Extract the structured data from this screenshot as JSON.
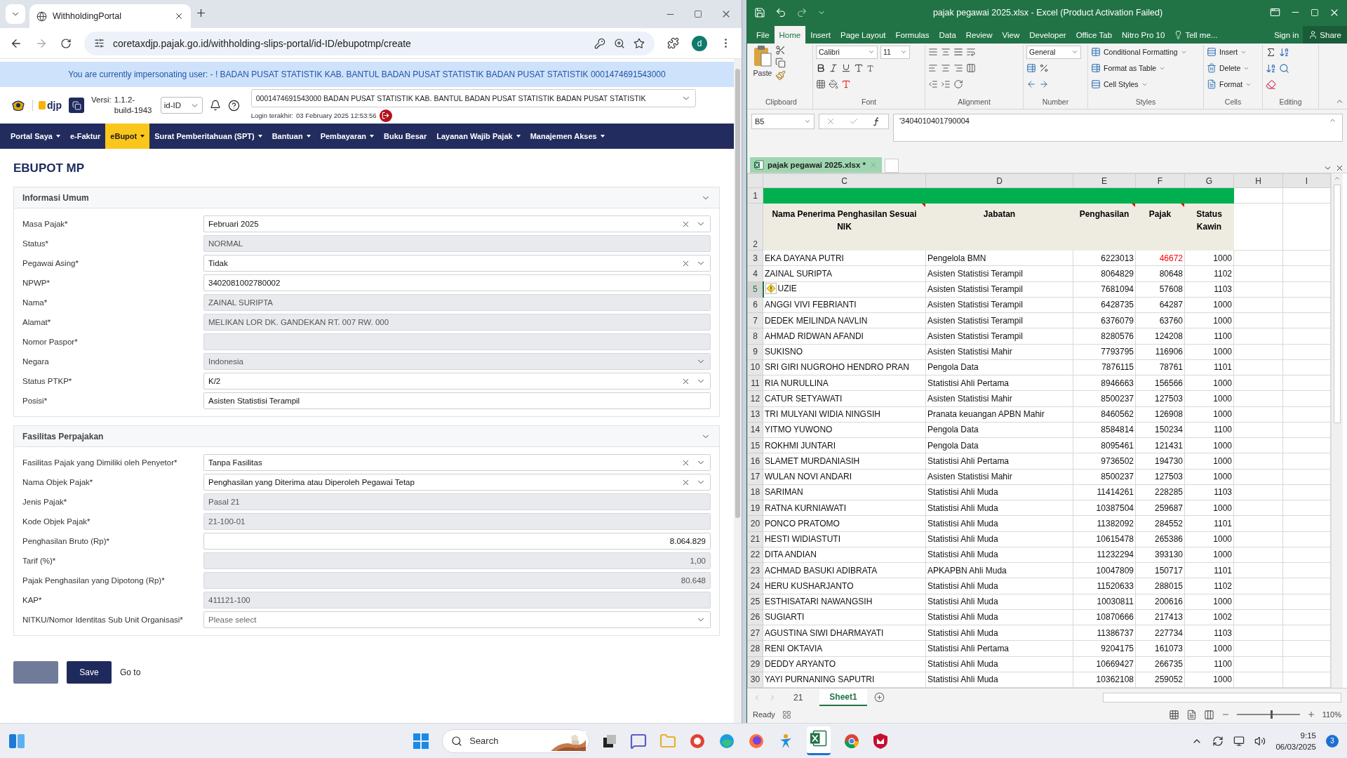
{
  "browser": {
    "tab_title": "WithholdingPortal",
    "url": "coretaxdjp.pajak.go.id/withholding-slips-portal/id-ID/ebupotmp/create",
    "profile_initial": "d"
  },
  "portal": {
    "banner": "You are currently impersonating user: - ! BADAN PUSAT STATISTIK KAB. BANTUL BADAN PUSAT STATISTIK BADAN PUSAT STATISTIK 0001474691543000",
    "logo_text": "djp",
    "version_label": "Versi:",
    "version": "1.1.2-build-1943",
    "language": "id-ID",
    "company": "0001474691543000 BADAN PUSAT STATISTIK KAB. BANTUL BADAN PUSAT STATISTIK BADAN PUSAT STATISTIK",
    "login_label": "Login terakhir:",
    "login_time": "03 February 2025 12:53:56",
    "nav": [
      {
        "label": "Portal Saya",
        "dropdown": true,
        "selected": false
      },
      {
        "label": "e-Faktur",
        "dropdown": false,
        "selected": false
      },
      {
        "label": "eBupot",
        "dropdown": true,
        "selected": true
      },
      {
        "label": "Surat Pemberitahuan (SPT)",
        "dropdown": true,
        "selected": false
      },
      {
        "label": "Bantuan",
        "dropdown": true,
        "selected": false
      },
      {
        "label": "Pembayaran",
        "dropdown": true,
        "selected": false
      },
      {
        "label": "Buku Besar",
        "dropdown": false,
        "selected": false
      },
      {
        "label": "Layanan Wajib Pajak",
        "dropdown": true,
        "selected": false
      },
      {
        "label": "Manajemen Akses",
        "dropdown": true,
        "selected": false
      }
    ],
    "title": "EBUPOT MP",
    "sections": [
      {
        "title": "Informasi Umum",
        "expanded": true,
        "fields": [
          {
            "label": "Masa Pajak*",
            "kind": "select",
            "disabled": false,
            "clearable": true,
            "value": "Februari 2025"
          },
          {
            "label": "Status*",
            "kind": "text",
            "disabled": true,
            "value": "NORMAL"
          },
          {
            "label": "Pegawai Asing*",
            "kind": "select",
            "disabled": false,
            "clearable": true,
            "value": "Tidak"
          },
          {
            "label": "NPWP*",
            "kind": "text",
            "disabled": false,
            "value": "3402081002780002"
          },
          {
            "label": "Nama*",
            "kind": "text",
            "disabled": true,
            "value": "ZAINAL SURIPTA"
          },
          {
            "label": "Alamat*",
            "kind": "text",
            "disabled": true,
            "value": "MELIKAN LOR DK. GANDEKAN RT. 007 RW. 000"
          },
          {
            "label": "Nomor Paspor*",
            "kind": "text",
            "disabled": true
          },
          {
            "label": "Negara",
            "kind": "select",
            "disabled": true,
            "clearable": false,
            "value": "Indonesia"
          },
          {
            "label": "Status PTKP*",
            "kind": "select",
            "disabled": false,
            "clearable": true,
            "value": "K/2"
          },
          {
            "label": "Posisi*",
            "kind": "text",
            "disabled": false,
            "value": "Asisten Statistisi Terampil"
          }
        ]
      },
      {
        "title": "Fasilitas Perpajakan",
        "expanded": true,
        "fields": [
          {
            "label": "Fasilitas Pajak yang Dimiliki oleh Penyetor*",
            "kind": "select",
            "disabled": false,
            "clearable": true,
            "value": "Tanpa Fasilitas"
          },
          {
            "label": "Nama Objek Pajak*",
            "kind": "select",
            "disabled": false,
            "clearable": true,
            "value": "Penghasilan yang Diterima atau Diperoleh Pegawai Tetap"
          },
          {
            "label": "Jenis Pajak*",
            "kind": "text",
            "disabled": true,
            "value": "Pasal 21"
          },
          {
            "label": "Kode Objek Pajak*",
            "kind": "text",
            "disabled": true,
            "value": "21-100-01"
          },
          {
            "label": "Penghasilan Bruto (Rp)*",
            "kind": "number",
            "disabled": false,
            "value": "8.064.829"
          },
          {
            "label": "Tarif (%)*",
            "kind": "number",
            "disabled": true,
            "value": "1,00"
          },
          {
            "label": "Pajak Penghasilan yang Dipotong (Rp)*",
            "kind": "number",
            "disabled": true,
            "value": "80.648"
          },
          {
            "label": "KAP*",
            "kind": "text",
            "disabled": true,
            "value": "411121-100"
          },
          {
            "label": "NITKU/Nomor Identitas Sub Unit Organisasi*",
            "kind": "select",
            "disabled": false,
            "clearable": false,
            "placeholder": "Please select"
          }
        ]
      }
    ],
    "buttons": [
      {
        "kind": "secondary"
      },
      {
        "kind": "primary",
        "label": "Save"
      },
      {
        "kind": "link",
        "label": "Go to"
      }
    ]
  },
  "excel": {
    "title": "pajak pegawai 2025.xlsx - Excel (Product Activation Failed)",
    "tabs": [
      {
        "label": "File",
        "selected": false
      },
      {
        "label": "Home",
        "selected": true
      },
      {
        "label": "Insert",
        "selected": false
      },
      {
        "label": "Page Layout",
        "selected": false
      },
      {
        "label": "Formulas",
        "selected": false
      },
      {
        "label": "Data",
        "selected": false
      },
      {
        "label": "Review",
        "selected": false
      },
      {
        "label": "View",
        "selected": false
      },
      {
        "label": "Developer",
        "selected": false
      },
      {
        "label": "Office Tab",
        "selected": false
      },
      {
        "label": "Nitro Pro 10",
        "selected": false
      }
    ],
    "tell_me": "Tell me...",
    "sign_in": "Sign in",
    "share": "Share",
    "ribbon": {
      "clipboard": "Clipboard",
      "paste": "Paste",
      "font_group": "Font",
      "font": "Calibri",
      "size": "11",
      "alignment": "Alignment",
      "number_group": "Number",
      "number_format": "General",
      "styles_group": "Styles",
      "styles": [
        "Conditional Formatting",
        "Format as Table",
        "Cell Styles"
      ],
      "cells_group": "Cells",
      "cells": [
        "Insert",
        "Delete",
        "Format"
      ],
      "editing": "Editing"
    },
    "name_box": "B5",
    "formula": "'3404010401790004",
    "workbook_tab": "pajak pegawai 2025.xlsx *",
    "columns": [
      "C",
      "D",
      "E",
      "F",
      "G",
      "H",
      "I"
    ],
    "header_rows": [
      "1",
      "2"
    ],
    "headers": [
      {
        "text": "Nama Penerima Penghasilan Sesuai NIK",
        "comment": true
      },
      {
        "text": "Jabatan",
        "comment": false
      },
      {
        "text": "Penghasilan",
        "comment": true
      },
      {
        "text": "Pajak",
        "comment": true
      },
      {
        "text": "Status Kawin",
        "comment": false
      }
    ],
    "rows": [
      {
        "row": "3",
        "name": "EKA DAYANA PUTRI",
        "jabatan": "Pengelola BMN",
        "penghasilan": "6223013",
        "pajak": "46672",
        "status": "1000",
        "pajak_red": true,
        "selected": false,
        "warning": false
      },
      {
        "row": "4",
        "name": "ZAINAL SURIPTA",
        "jabatan": "Asisten Statistisi Terampil",
        "penghasilan": "8064829",
        "pajak": "80648",
        "status": "1102",
        "pajak_red": false,
        "selected": false,
        "warning": false
      },
      {
        "row": "5",
        "name": "UZIE",
        "jabatan": "Asisten Statistisi Terampil",
        "penghasilan": "7681094",
        "pajak": "57608",
        "status": "1103",
        "pajak_red": false,
        "selected": true,
        "warning": true
      },
      {
        "row": "6",
        "name": "ANGGI VIVI FEBRIANTI",
        "jabatan": "Asisten Statistisi Terampil",
        "penghasilan": "6428735",
        "pajak": "64287",
        "status": "1000",
        "pajak_red": false,
        "selected": false,
        "warning": false
      },
      {
        "row": "7",
        "name": "DEDEK MEILINDA NAVLIN",
        "jabatan": "Asisten Statistisi Terampil",
        "penghasilan": "6376079",
        "pajak": "63760",
        "status": "1000",
        "pajak_red": false,
        "selected": false,
        "warning": false
      },
      {
        "row": "8",
        "name": "AHMAD RIDWAN AFANDI",
        "jabatan": "Asisten Statistisi Terampil",
        "penghasilan": "8280576",
        "pajak": "124208",
        "status": "1100",
        "pajak_red": false,
        "selected": false,
        "warning": false
      },
      {
        "row": "9",
        "name": "SUKISNO",
        "jabatan": "Asisten Statistisi Mahir",
        "penghasilan": "7793795",
        "pajak": "116906",
        "status": "1000",
        "pajak_red": false,
        "selected": false,
        "warning": false
      },
      {
        "row": "10",
        "name": "SRI GIRI NUGROHO HENDRO PRAN",
        "jabatan": "Pengola Data",
        "penghasilan": "7876115",
        "pajak": "78761",
        "status": "1101",
        "pajak_red": false,
        "selected": false,
        "warning": false
      },
      {
        "row": "11",
        "name": "RIA NURULLINA",
        "jabatan": "Statistisi Ahli Pertama",
        "penghasilan": "8946663",
        "pajak": "156566",
        "status": "1000",
        "pajak_red": false,
        "selected": false,
        "warning": false
      },
      {
        "row": "12",
        "name": "CATUR SETYAWATI",
        "jabatan": "Asisten Statistisi Mahir",
        "penghasilan": "8500237",
        "pajak": "127503",
        "status": "1000",
        "pajak_red": false,
        "selected": false,
        "warning": false
      },
      {
        "row": "13",
        "name": "TRI MULYANI WIDIA NINGSIH",
        "jabatan": "Pranata keuangan APBN Mahir",
        "penghasilan": "8460562",
        "pajak": "126908",
        "status": "1000",
        "pajak_red": false,
        "selected": false,
        "warning": false
      },
      {
        "row": "14",
        "name": "YITMO YUWONO",
        "jabatan": "Pengola Data",
        "penghasilan": "8584814",
        "pajak": "150234",
        "status": "1100",
        "pajak_red": false,
        "selected": false,
        "warning": false
      },
      {
        "row": "15",
        "name": "ROKHMI JUNTARI",
        "jabatan": "Pengola Data",
        "penghasilan": "8095461",
        "pajak": "121431",
        "status": "1000",
        "pajak_red": false,
        "selected": false,
        "warning": false
      },
      {
        "row": "16",
        "name": "SLAMET MURDANIASIH",
        "jabatan": "Statistisi Ahli Pertama",
        "penghasilan": "9736502",
        "pajak": "194730",
        "status": "1000",
        "pajak_red": false,
        "selected": false,
        "warning": false
      },
      {
        "row": "17",
        "name": "WULAN NOVI ANDARI",
        "jabatan": "Asisten Statistisi Mahir",
        "penghasilan": "8500237",
        "pajak": "127503",
        "status": "1000",
        "pajak_red": false,
        "selected": false,
        "warning": false
      },
      {
        "row": "18",
        "name": "SARIMAN",
        "jabatan": "Statistisi Ahli Muda",
        "penghasilan": "11414261",
        "pajak": "228285",
        "status": "1103",
        "pajak_red": false,
        "selected": false,
        "warning": false
      },
      {
        "row": "19",
        "name": "RATNA KURNIAWATI",
        "jabatan": "Statistisi Ahli Muda",
        "penghasilan": "10387504",
        "pajak": "259687",
        "status": "1000",
        "pajak_red": false,
        "selected": false,
        "warning": false
      },
      {
        "row": "20",
        "name": "PONCO PRATOMO",
        "jabatan": "Statistisi Ahli Muda",
        "penghasilan": "11382092",
        "pajak": "284552",
        "status": "1101",
        "pajak_red": false,
        "selected": false,
        "warning": false
      },
      {
        "row": "21",
        "name": "HESTI WIDIASTUTI",
        "jabatan": "Statistisi Ahli Muda",
        "penghasilan": "10615478",
        "pajak": "265386",
        "status": "1000",
        "pajak_red": false,
        "selected": false,
        "warning": false
      },
      {
        "row": "22",
        "name": "DITA ANDIAN",
        "jabatan": "Statistisi Ahli Muda",
        "penghasilan": "11232294",
        "pajak": "393130",
        "status": "1000",
        "pajak_red": false,
        "selected": false,
        "warning": false
      },
      {
        "row": "23",
        "name": "ACHMAD BASUKI ADIBRATA",
        "jabatan": "APKAPBN Ahli Muda",
        "penghasilan": "10047809",
        "pajak": "150717",
        "status": "1101",
        "pajak_red": false,
        "selected": false,
        "warning": false
      },
      {
        "row": "24",
        "name": "HERU KUSHARJANTO",
        "jabatan": "Statistisi Ahli Muda",
        "penghasilan": "11520633",
        "pajak": "288015",
        "status": "1102",
        "pajak_red": false,
        "selected": false,
        "warning": false
      },
      {
        "row": "25",
        "name": "ESTHISATARI NAWANGSIH",
        "jabatan": "Statistisi Ahli Muda",
        "penghasilan": "10030811",
        "pajak": "200616",
        "status": "1000",
        "pajak_red": false,
        "selected": false,
        "warning": false
      },
      {
        "row": "26",
        "name": "SUGIARTI",
        "jabatan": "Statistisi Ahli Muda",
        "penghasilan": "10870666",
        "pajak": "217413",
        "status": "1002",
        "pajak_red": false,
        "selected": false,
        "warning": false
      },
      {
        "row": "27",
        "name": "AGUSTINA SIWI DHARMAYATI",
        "jabatan": "Statistisi Ahli Muda",
        "penghasilan": "11386737",
        "pajak": "227734",
        "status": "1103",
        "pajak_red": false,
        "selected": false,
        "warning": false
      },
      {
        "row": "28",
        "name": "RENI OKTAVIA",
        "jabatan": "Statistisi Ahli Pertama",
        "penghasilan": "9204175",
        "pajak": "161073",
        "status": "1000",
        "pajak_red": false,
        "selected": false,
        "warning": false
      },
      {
        "row": "29",
        "name": "DEDDY ARYANTO",
        "jabatan": "Statistisi Ahli Muda",
        "penghasilan": "10669427",
        "pajak": "266735",
        "status": "1100",
        "pajak_red": false,
        "selected": false,
        "warning": false
      },
      {
        "row": "30",
        "name": "YAYI PURNANING SAPUTRI",
        "jabatan": "Statistisi Ahli Muda",
        "penghasilan": "10362108",
        "pajak": "259052",
        "status": "1000",
        "pajak_red": false,
        "selected": false,
        "warning": false
      }
    ],
    "sheets": [
      {
        "label": "21",
        "selected": false
      },
      {
        "label": "Sheet1",
        "selected": true
      }
    ],
    "status": "Ready",
    "zoom": "110%",
    "zoom_slider": {
      "level": 0.55
    }
  },
  "taskbar": {
    "search": "Search",
    "time": "9:15",
    "date": "06/03/2025",
    "notifications": "3"
  }
}
